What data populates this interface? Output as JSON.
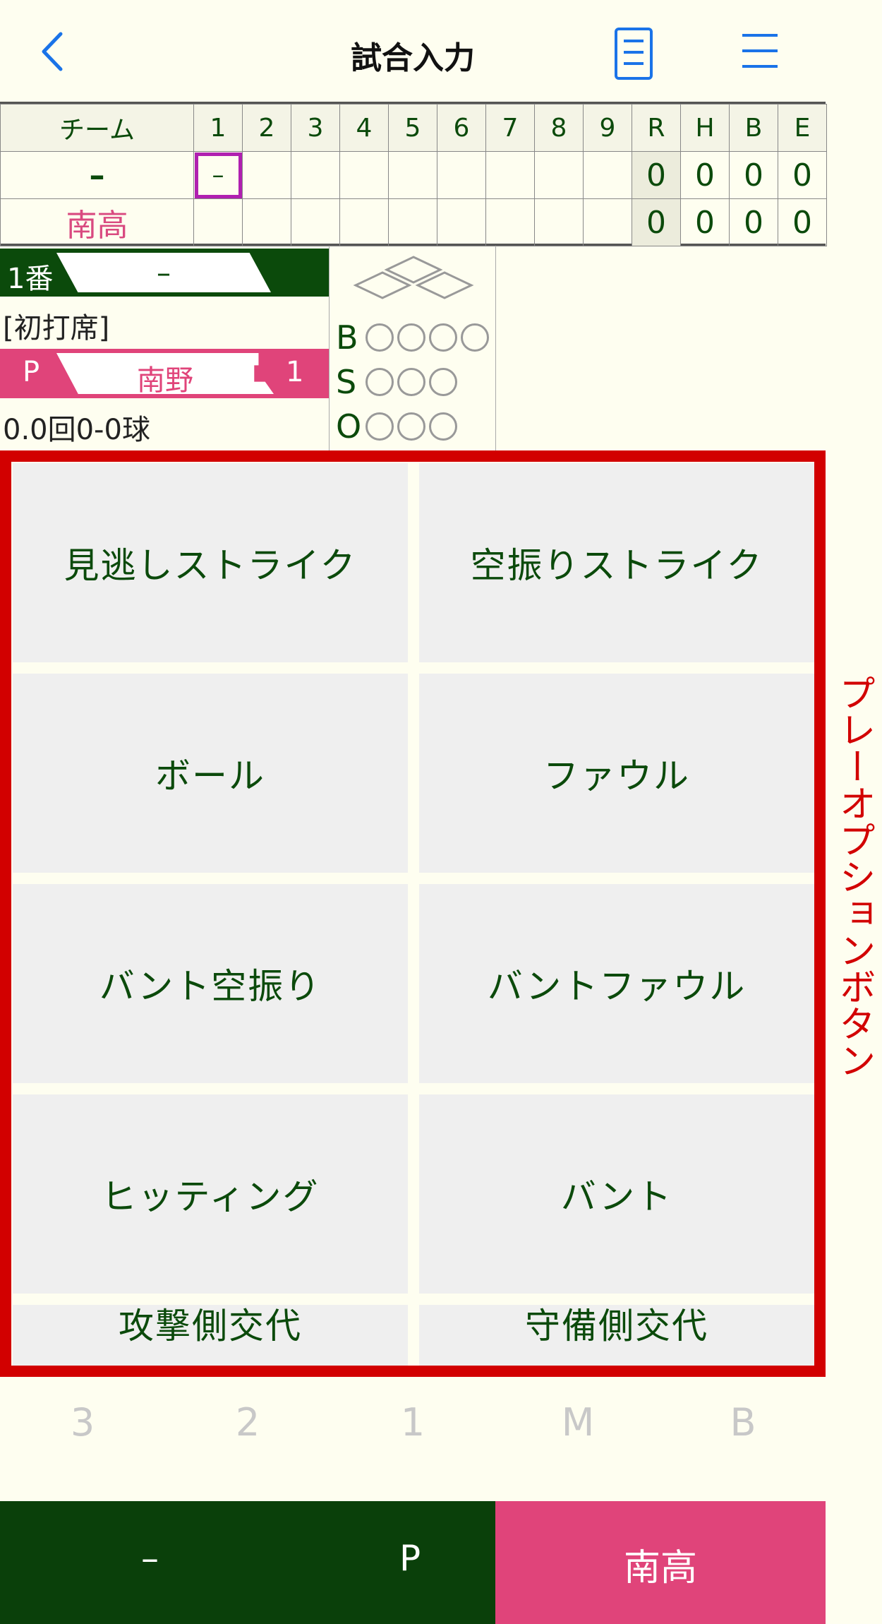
{
  "header": {
    "title": "試合入力",
    "back_icon": "chevron-left-icon",
    "doc_icon": "document-icon",
    "menu_icon": "hamburger-menu-icon",
    "accent_color": "#1a73e8"
  },
  "scoreboard": {
    "team_header": "チーム",
    "innings": [
      "1",
      "2",
      "3",
      "4",
      "5",
      "6",
      "7",
      "8",
      "9"
    ],
    "stat_headers": [
      "R",
      "H",
      "B",
      "E"
    ],
    "rows": [
      {
        "team": "–",
        "innings": [
          "–",
          "",
          "",
          "",
          "",
          "",
          "",
          "",
          ""
        ],
        "stats": [
          "0",
          "0",
          "0",
          "0"
        ]
      },
      {
        "team": "南高",
        "innings": [
          "",
          "",
          "",
          "",
          "",
          "",
          "",
          "",
          ""
        ],
        "stats": [
          "0",
          "0",
          "0",
          "0"
        ]
      }
    ]
  },
  "batter": {
    "order": "1番",
    "name": "–",
    "status": "[初打席]"
  },
  "pitcher": {
    "position": "P",
    "name": "南野",
    "number": "1",
    "stats": "0.0回0-0球"
  },
  "count": {
    "labels": [
      "B",
      "S",
      "O"
    ],
    "ball_dots": 4,
    "strike_dots": 3,
    "out_dots": 3
  },
  "options": {
    "buttons": [
      "見逃しストライク",
      "空振りストライク",
      "ボール",
      "ファウル",
      "バント空振り",
      "バントファウル",
      "ヒッティング",
      "バント",
      "攻撃側交代",
      "守備側交代"
    ],
    "side_label": "プレーオプションボタン",
    "highlight_color": "#d20000"
  },
  "positions": [
    "3",
    "2",
    "1",
    "M",
    "B"
  ],
  "bottom_bar": {
    "left_name": "–",
    "left_position": "P",
    "right_name": "南高",
    "left_color": "#0a400a",
    "right_color": "#e0447a"
  }
}
